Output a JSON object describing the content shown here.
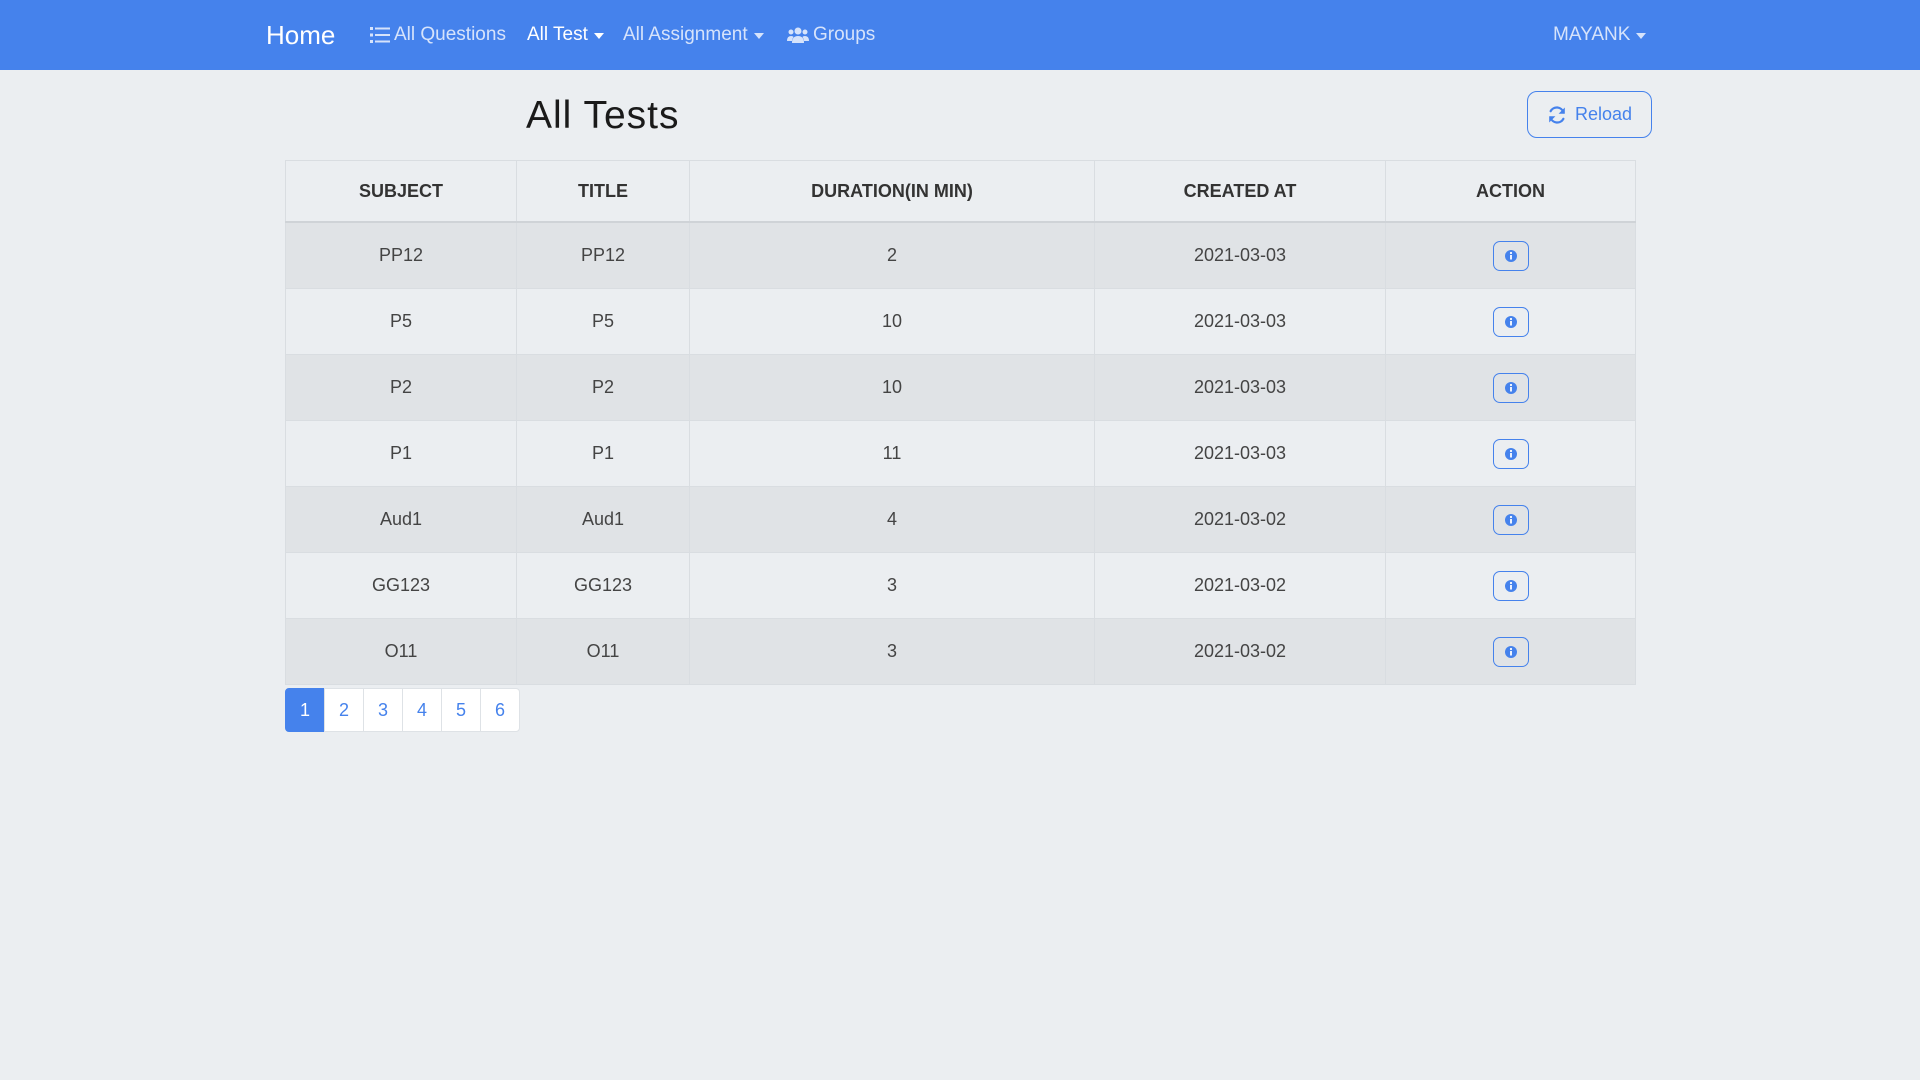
{
  "nav": {
    "brand": "Home",
    "items": [
      {
        "label": "All Questions",
        "icon": "list-icon",
        "dropdown": false,
        "active": false
      },
      {
        "label": "All Test",
        "dropdown": true,
        "active": true
      },
      {
        "label": "All Assignment",
        "dropdown": true,
        "active": false
      },
      {
        "label": "Groups",
        "icon": "users-icon",
        "dropdown": false,
        "active": false
      }
    ],
    "user": "MAYANK"
  },
  "page": {
    "title": "All Tests",
    "reload_label": "Reload"
  },
  "table": {
    "headers": [
      "SUBJECT",
      "TITLE",
      "DURATION(IN MIN)",
      "CREATED AT",
      "ACTION"
    ],
    "rows": [
      {
        "subject": "PP12",
        "title": "PP12",
        "duration": "2",
        "created_at": "2021-03-03"
      },
      {
        "subject": "P5",
        "title": "P5",
        "duration": "10",
        "created_at": "2021-03-03"
      },
      {
        "subject": "P2",
        "title": "P2",
        "duration": "10",
        "created_at": "2021-03-03"
      },
      {
        "subject": "P1",
        "title": "P1",
        "duration": "11",
        "created_at": "2021-03-03"
      },
      {
        "subject": "Aud1",
        "title": "Aud1",
        "duration": "4",
        "created_at": "2021-03-02"
      },
      {
        "subject": "GG123",
        "title": "GG123",
        "duration": "3",
        "created_at": "2021-03-02"
      },
      {
        "subject": "O11",
        "title": "O11",
        "duration": "3",
        "created_at": "2021-03-02"
      }
    ],
    "action_icon": "info-icon"
  },
  "pagination": {
    "pages": [
      "1",
      "2",
      "3",
      "4",
      "5",
      "6"
    ],
    "current": "1"
  },
  "colors": {
    "primary": "#4582ec",
    "background": "#ebeef1",
    "row_striped": "#e0e3e6"
  }
}
